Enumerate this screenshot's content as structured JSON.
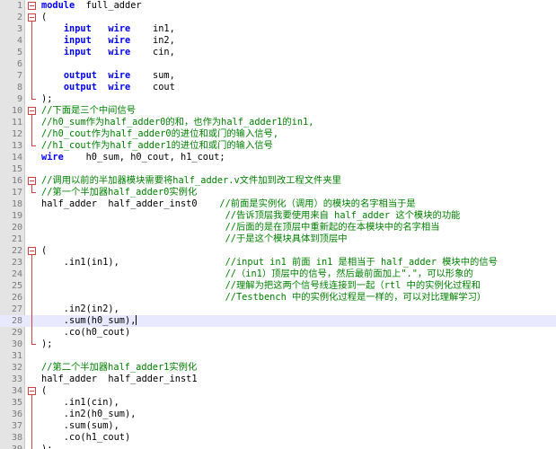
{
  "editor": {
    "active_line": 28,
    "lines": [
      {
        "n": "1",
        "fold": "open",
        "segs": [
          {
            "t": "kw",
            "v": "module"
          },
          {
            "t": "",
            "v": "  full_adder"
          }
        ]
      },
      {
        "n": "2",
        "fold": "open",
        "segs": [
          {
            "t": "",
            "v": "("
          }
        ]
      },
      {
        "n": "3",
        "fold": "line",
        "segs": [
          {
            "t": "",
            "v": "    "
          },
          {
            "t": "kw",
            "v": "input"
          },
          {
            "t": "",
            "v": "   "
          },
          {
            "t": "kw",
            "v": "wire"
          },
          {
            "t": "",
            "v": "    in1,"
          }
        ]
      },
      {
        "n": "4",
        "fold": "line",
        "segs": [
          {
            "t": "",
            "v": "    "
          },
          {
            "t": "kw",
            "v": "input"
          },
          {
            "t": "",
            "v": "   "
          },
          {
            "t": "kw",
            "v": "wire"
          },
          {
            "t": "",
            "v": "    in2,"
          }
        ]
      },
      {
        "n": "5",
        "fold": "line",
        "segs": [
          {
            "t": "",
            "v": "    "
          },
          {
            "t": "kw",
            "v": "input"
          },
          {
            "t": "",
            "v": "   "
          },
          {
            "t": "kw",
            "v": "wire"
          },
          {
            "t": "",
            "v": "    cin,"
          }
        ]
      },
      {
        "n": "6",
        "fold": "line",
        "segs": []
      },
      {
        "n": "7",
        "fold": "line",
        "segs": [
          {
            "t": "",
            "v": "    "
          },
          {
            "t": "kw",
            "v": "output"
          },
          {
            "t": "",
            "v": "  "
          },
          {
            "t": "kw",
            "v": "wire"
          },
          {
            "t": "",
            "v": "    sum,"
          }
        ]
      },
      {
        "n": "8",
        "fold": "line",
        "segs": [
          {
            "t": "",
            "v": "    "
          },
          {
            "t": "kw",
            "v": "output"
          },
          {
            "t": "",
            "v": "  "
          },
          {
            "t": "kw",
            "v": "wire"
          },
          {
            "t": "",
            "v": "    cout"
          }
        ]
      },
      {
        "n": "9",
        "fold": "end",
        "segs": [
          {
            "t": "",
            "v": ");"
          }
        ]
      },
      {
        "n": "10",
        "fold": "open",
        "segs": [
          {
            "t": "cm",
            "v": "//下面是三个中间信号"
          }
        ]
      },
      {
        "n": "11",
        "fold": "line",
        "segs": [
          {
            "t": "cm",
            "v": "//h0_sum作为half_adder0的和，也作为half_adder1的in1,"
          }
        ]
      },
      {
        "n": "12",
        "fold": "line",
        "segs": [
          {
            "t": "cm",
            "v": "//h0_cout作为half_adder0的进位和或门的输入信号,"
          }
        ]
      },
      {
        "n": "13",
        "fold": "end",
        "segs": [
          {
            "t": "cm",
            "v": "//h1_cout作为half_adder1的进位和或门的输入信号"
          }
        ]
      },
      {
        "n": "14",
        "fold": "",
        "segs": [
          {
            "t": "kw",
            "v": "wire"
          },
          {
            "t": "",
            "v": "    h0_sum, h0_cout, h1_cout;"
          }
        ]
      },
      {
        "n": "15",
        "fold": "",
        "segs": []
      },
      {
        "n": "16",
        "fold": "open",
        "segs": [
          {
            "t": "cm",
            "v": "//调用以前的半加器模块需要将half_adder.v文件加到改工程文件夹里"
          }
        ]
      },
      {
        "n": "17",
        "fold": "end",
        "segs": [
          {
            "t": "cm",
            "v": "//第一个半加器half_adder0实例化"
          }
        ]
      },
      {
        "n": "18",
        "fold": "",
        "segs": [
          {
            "t": "",
            "v": "half_adder  half_adder_inst0    "
          },
          {
            "t": "cm",
            "v": "//前面是实例化（调用）的模块的名字相当于是"
          }
        ]
      },
      {
        "n": "19",
        "fold": "",
        "segs": [
          {
            "t": "",
            "v": "                                 "
          },
          {
            "t": "cm",
            "v": "//告诉顶层我要使用来自 half_adder 这个模块的功能"
          }
        ]
      },
      {
        "n": "20",
        "fold": "",
        "segs": [
          {
            "t": "",
            "v": "                                 "
          },
          {
            "t": "cm",
            "v": "//后面的是在顶层中重新起的在本模块中的名字相当"
          }
        ]
      },
      {
        "n": "21",
        "fold": "",
        "segs": [
          {
            "t": "",
            "v": "                                 "
          },
          {
            "t": "cm",
            "v": "//于是这个模块具体到顶层中"
          }
        ]
      },
      {
        "n": "22",
        "fold": "open",
        "segs": [
          {
            "t": "",
            "v": "("
          }
        ]
      },
      {
        "n": "23",
        "fold": "line",
        "segs": [
          {
            "t": "",
            "v": "    .in1(in1),                   "
          },
          {
            "t": "cm",
            "v": "//input in1 前面 in1 是相当于 half_adder 模块中的信号"
          }
        ]
      },
      {
        "n": "24",
        "fold": "line",
        "segs": [
          {
            "t": "",
            "v": "                                 "
          },
          {
            "t": "cm",
            "v": "//（in1）顶层中的信号，然后最前面加上\".\"，可以形象的"
          }
        ]
      },
      {
        "n": "25",
        "fold": "line",
        "segs": [
          {
            "t": "",
            "v": "                                 "
          },
          {
            "t": "cm",
            "v": "//理解为把这两个信号线连接到一起（rtl 中的实例化过程和"
          }
        ]
      },
      {
        "n": "26",
        "fold": "line",
        "segs": [
          {
            "t": "",
            "v": "                                 "
          },
          {
            "t": "cm",
            "v": "//Testbench 中的实例化过程是一样的，可以对比理解学习）"
          }
        ]
      },
      {
        "n": "27",
        "fold": "line",
        "segs": [
          {
            "t": "",
            "v": "    .in2(in2),"
          }
        ]
      },
      {
        "n": "28",
        "fold": "line",
        "segs": [
          {
            "t": "",
            "v": "    .sum(h0_sum),"
          }
        ],
        "cursor": true
      },
      {
        "n": "29",
        "fold": "line",
        "segs": [
          {
            "t": "",
            "v": "    .co(h0_cout)"
          }
        ]
      },
      {
        "n": "30",
        "fold": "end",
        "segs": [
          {
            "t": "",
            "v": ");"
          }
        ]
      },
      {
        "n": "31",
        "fold": "",
        "segs": []
      },
      {
        "n": "32",
        "fold": "",
        "segs": [
          {
            "t": "cm",
            "v": "//第二个半加器half_adder1实例化"
          }
        ]
      },
      {
        "n": "33",
        "fold": "",
        "segs": [
          {
            "t": "",
            "v": "half_adder  half_adder_inst1"
          }
        ]
      },
      {
        "n": "34",
        "fold": "open",
        "segs": [
          {
            "t": "",
            "v": "("
          }
        ]
      },
      {
        "n": "35",
        "fold": "line",
        "segs": [
          {
            "t": "",
            "v": "    .in1(cin),"
          }
        ]
      },
      {
        "n": "36",
        "fold": "line",
        "segs": [
          {
            "t": "",
            "v": "    .in2(h0_sum),"
          }
        ]
      },
      {
        "n": "37",
        "fold": "line",
        "segs": [
          {
            "t": "",
            "v": "    .sum(sum),"
          }
        ]
      },
      {
        "n": "38",
        "fold": "line",
        "segs": [
          {
            "t": "",
            "v": "    .co(h1_cout)"
          }
        ]
      },
      {
        "n": "39",
        "fold": "end",
        "segs": [
          {
            "t": "",
            "v": ");"
          }
        ]
      }
    ]
  },
  "colors": {
    "keyword": "#0000ff",
    "comment": "#008000",
    "text": "#000000",
    "gutter": "#e4e4e4",
    "line_number": "#7a7a7a",
    "fold_marker": "#d04040",
    "active_line": "#e8e8ff"
  }
}
